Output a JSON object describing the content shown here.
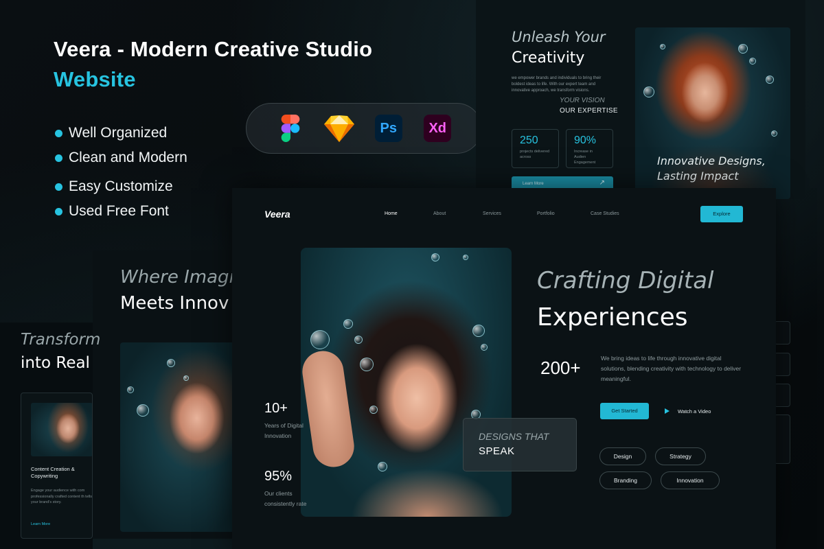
{
  "promo": {
    "title_line1": "Veera - Modern Creative Studio",
    "title_line2": "Website",
    "features": [
      "Well Organized",
      "Clean and Modern",
      "Easy Customize",
      "Used Free Font"
    ],
    "tools": [
      {
        "name": "figma-icon"
      },
      {
        "name": "sketch-icon"
      },
      {
        "name": "photoshop-icon",
        "label": "Ps"
      },
      {
        "name": "xd-icon",
        "label": "Xd"
      }
    ]
  },
  "back_card_top": {
    "heading_italic": "Unleash Your",
    "heading": "Creativity",
    "paragraph": "we empower brands and individuals to bring their boldest ideas to life. With our expert team and innovative approach, we transform visions.",
    "vision_label": "YOUR VISION",
    "expertise_label": "OUR EXPERTISE",
    "stats": [
      {
        "value": "250",
        "desc": "projects delivered across"
      },
      {
        "value": "90%",
        "desc": "Increase in Audien Engagement"
      }
    ],
    "learn_more": "Learn More",
    "learn_more_arrow": "↗",
    "photo_caption_1": "Innovative Designs,",
    "photo_caption_2": "Lasting Impact"
  },
  "back_card_left2": {
    "heading_italic": "Where Imagin",
    "heading": "Meets Innov"
  },
  "back_card_left1": {
    "heading_italic": "Transform",
    "heading": "into Real",
    "service_title": "Content Creation & Copywriting",
    "service_text": "Engage your audience with com professionally crafted content th tells your brand's story.",
    "service_link": "Learn More"
  },
  "main_card": {
    "logo": "Veera",
    "nav": [
      "Home",
      "About",
      "Services",
      "Portfolio",
      "Case Studies"
    ],
    "active_nav": "Home",
    "explore": "Explore",
    "stats": [
      {
        "value": "10+",
        "desc_1": "Years of Digital",
        "desc_2": "Innovation"
      },
      {
        "value": "95%",
        "desc_1": "Our clients",
        "desc_2": "consistently rate"
      }
    ],
    "designs_italic": "DESIGNS THAT",
    "designs_bold": "SPEAK",
    "hero_italic": "Crafting Digital",
    "hero": "Experiences",
    "big_stat": "200+",
    "hero_paragraph": "We bring ideas to life through innovative digital solutions, blending creativity with technology to deliver meaningful.",
    "get_started": "Get Started",
    "watch_video": "Watch a Video",
    "tags": [
      "Design",
      "Strategy",
      "Branding",
      "Innovation"
    ]
  },
  "colors": {
    "accent": "#27c3e0",
    "background": "#070b0d",
    "card": "#0b1215"
  }
}
